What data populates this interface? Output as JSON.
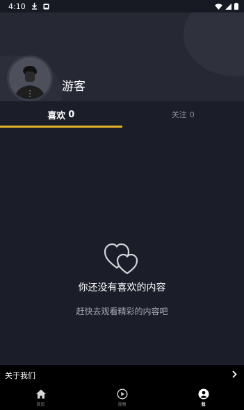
{
  "status_bar": {
    "time": "4:10"
  },
  "profile": {
    "username": "游客"
  },
  "tabs": [
    {
      "label": "喜欢",
      "count": "0"
    },
    {
      "label": "关注",
      "count": "0"
    }
  ],
  "empty_state": {
    "title": "你还没有喜欢的内容",
    "subtitle": "赶快去观看精彩的内容吧"
  },
  "about": {
    "label": "关于我们"
  },
  "bottom_nav": [
    {
      "label": "首页",
      "icon": "home-icon"
    },
    {
      "label": "视频",
      "icon": "play-icon"
    },
    {
      "label": "我",
      "icon": "user-icon"
    }
  ],
  "colors": {
    "accent": "#e2b529",
    "background": "#1b1d29",
    "header": "#262833"
  }
}
